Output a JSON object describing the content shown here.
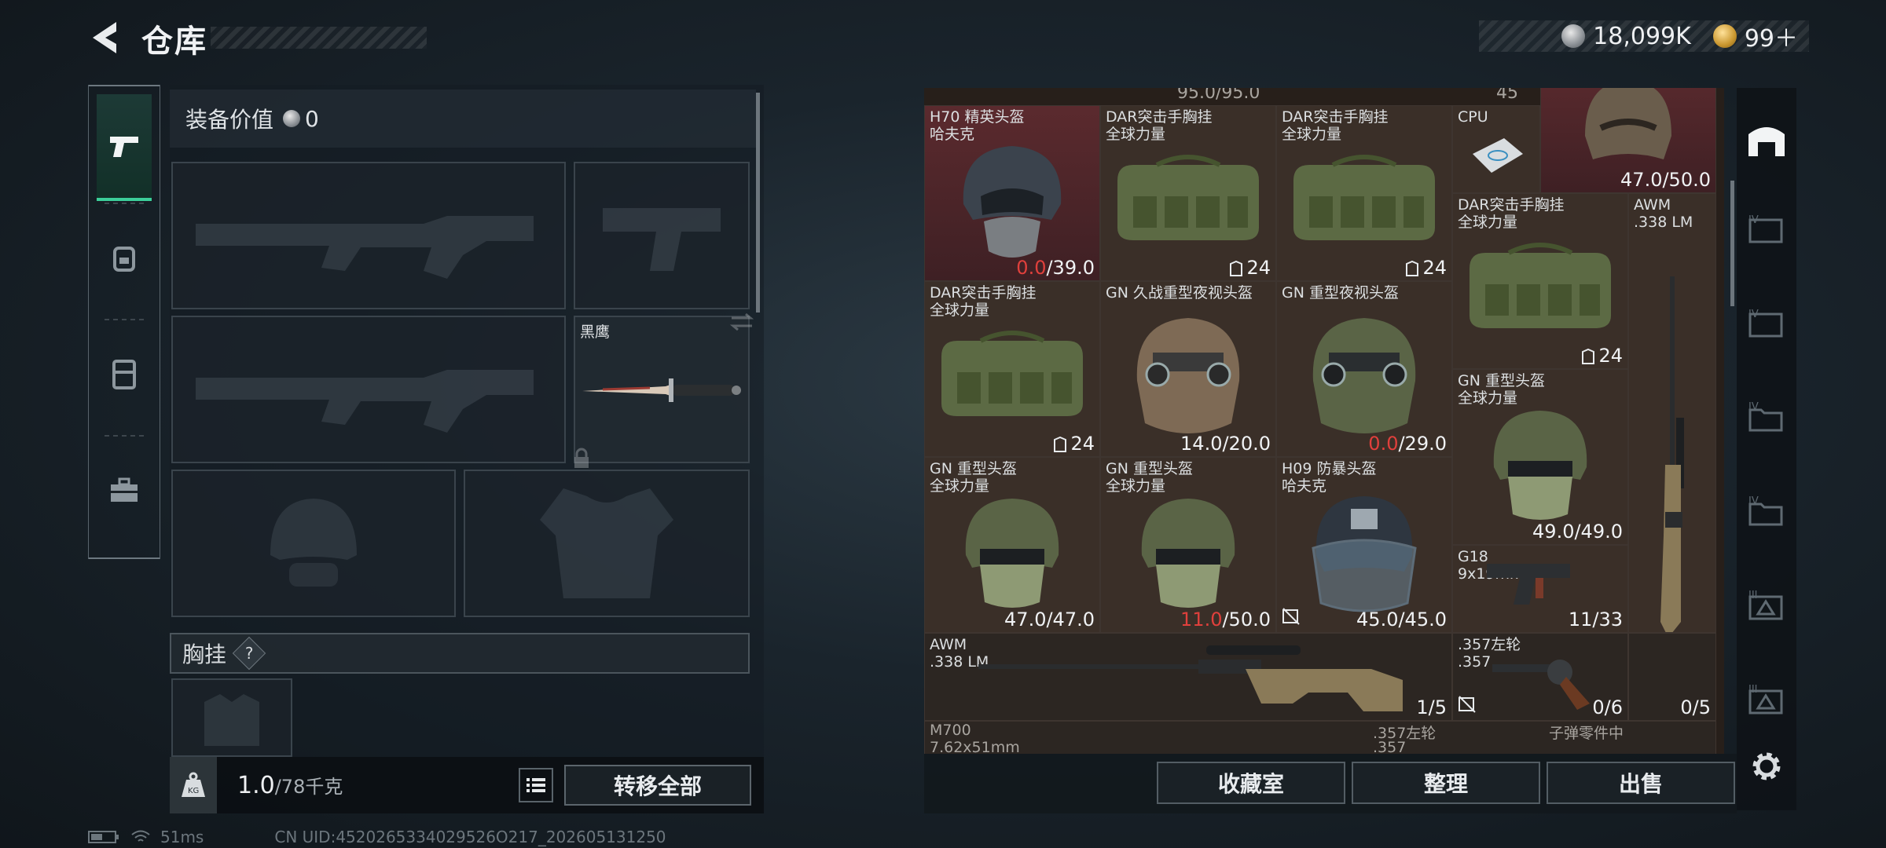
{
  "header": {
    "title": "仓库"
  },
  "currency": {
    "silver": "18,099K",
    "gold": "99＋"
  },
  "left_tabs": [
    "pistol-icon",
    "backpack-icon",
    "rig-icon",
    "toolbox-icon"
  ],
  "loadout": {
    "value_label": "装备价值",
    "value": "0",
    "knife_name": "黑鹰",
    "section_label": "胸挂",
    "help": "?",
    "weight_current": "1.0",
    "weight_max": "/78千克",
    "transfer_all": "转移全部"
  },
  "stash": {
    "cut_top": [
      "95.0/95.0",
      "45"
    ],
    "items": [
      {
        "name": "H70 精英头盔\n哈夫克",
        "dur_bad": "0.0",
        "dur": "/39.0"
      },
      {
        "name": "DAR突击手胸挂\n全球力量",
        "count": "24"
      },
      {
        "name": "DAR突击手胸挂\n全球力量",
        "count": "24"
      },
      {
        "name": "CPU"
      },
      {
        "name": "",
        "dur": "47.0/50.0"
      },
      {
        "name": "DAR突击手胸挂\n全球力量",
        "count": "24"
      },
      {
        "name": "AWM\n.338 LM"
      },
      {
        "name": "DAR突击手胸挂\n全球力量",
        "count": "24"
      },
      {
        "name": "GN 久战重型夜视头盔",
        "dur": "14.0/20.0"
      },
      {
        "name": "GN 重型夜视头盔",
        "dur_bad": "0.0",
        "dur": "/29.0"
      },
      {
        "name": "GN 重型头盔\n全球力量",
        "dur": "49.0/49.0"
      },
      {
        "name": "GN 重型头盔\n全球力量",
        "dur": "47.0/47.0"
      },
      {
        "name": "GN 重型头盔\n全球力量",
        "dur_bad": "11.0",
        "dur": "/50.0"
      },
      {
        "name": "H09 防暴头盔\n哈夫克",
        "dur": "45.0/45.0"
      },
      {
        "name": "G18\n9x19mm",
        "dur": "11/33"
      },
      {
        "name": "AWM\n.338 LM",
        "dur": "1/5"
      },
      {
        "name": ".357左轮\n.357",
        "dur": "0/6"
      },
      {
        "name": "",
        "dur": "0/5"
      }
    ],
    "cut_bottom": [
      "M700",
      "7.62x51mm",
      ".357左轮",
      ".357",
      "子弹零件中"
    ]
  },
  "rail": [
    "warehouse-icon",
    "tier-iv-case-icon-1",
    "tier-iv-case-icon-2",
    "tier-iv-folder-icon-1",
    "tier-iv-folder-icon-2",
    "tier-iii-case-icon-1",
    "tier-iii-case-icon-2"
  ],
  "actions": {
    "collection": "收藏室",
    "organize": "整理",
    "sell": "出售"
  },
  "status": {
    "ping": "51ms",
    "uid": "CN UID:4520265334029526O217_202605131250"
  }
}
